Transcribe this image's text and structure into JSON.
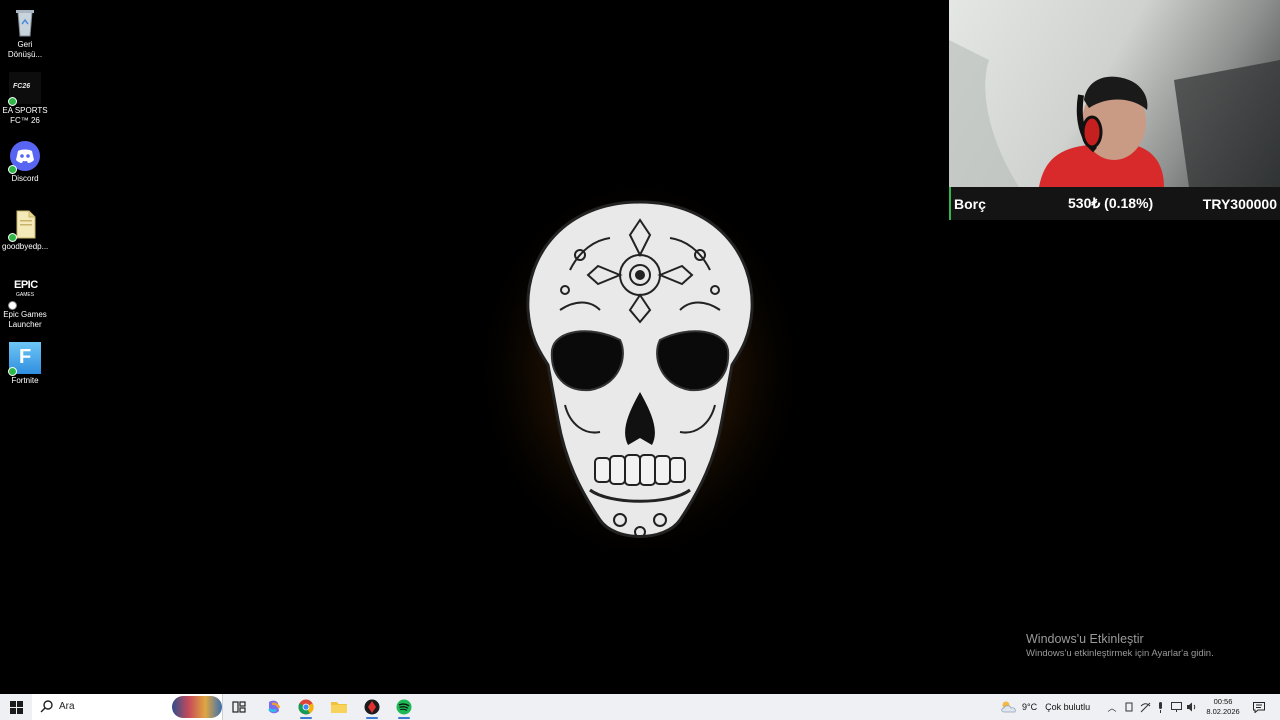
{
  "desktop_icons": [
    {
      "name": "recycle-bin",
      "label": "Geri\nDönüşü..."
    },
    {
      "name": "ea-sports-fc",
      "label": "EA SPORTS\nFC™ 26"
    },
    {
      "name": "discord",
      "label": "Discord"
    },
    {
      "name": "goodbyedpi",
      "label": "goodbyedp..."
    },
    {
      "name": "epic-games",
      "label": "Epic Games\nLauncher",
      "logo_text": "EPIC",
      "logo_sub": "GAMES"
    },
    {
      "name": "fortnite",
      "label": "Fortnite",
      "logo_text": "F"
    }
  ],
  "overlay": {
    "label": "Borç",
    "change": "530₺ (0.18%)",
    "value": "TRY300000"
  },
  "activation": {
    "title": "Windows'u Etkinleştir",
    "subtitle": "Windows'u etkinleştirmek için Ayarlar'a gidin."
  },
  "taskbar": {
    "search_placeholder": "Ara",
    "apps": [
      "task-view",
      "copilot",
      "chrome",
      "file-explorer",
      "app-red-black",
      "spotify"
    ],
    "weather_temp": "9°C",
    "weather_condition": "Çok bulutlu",
    "time": "00:56",
    "date": "8.02.2026"
  },
  "colors": {
    "desktop_bg": "#000000",
    "taskbar_bg": "#eef0f3",
    "overlay_accent": "#2fb84a",
    "discord": "#5865f2",
    "spotify": "#1db954"
  }
}
